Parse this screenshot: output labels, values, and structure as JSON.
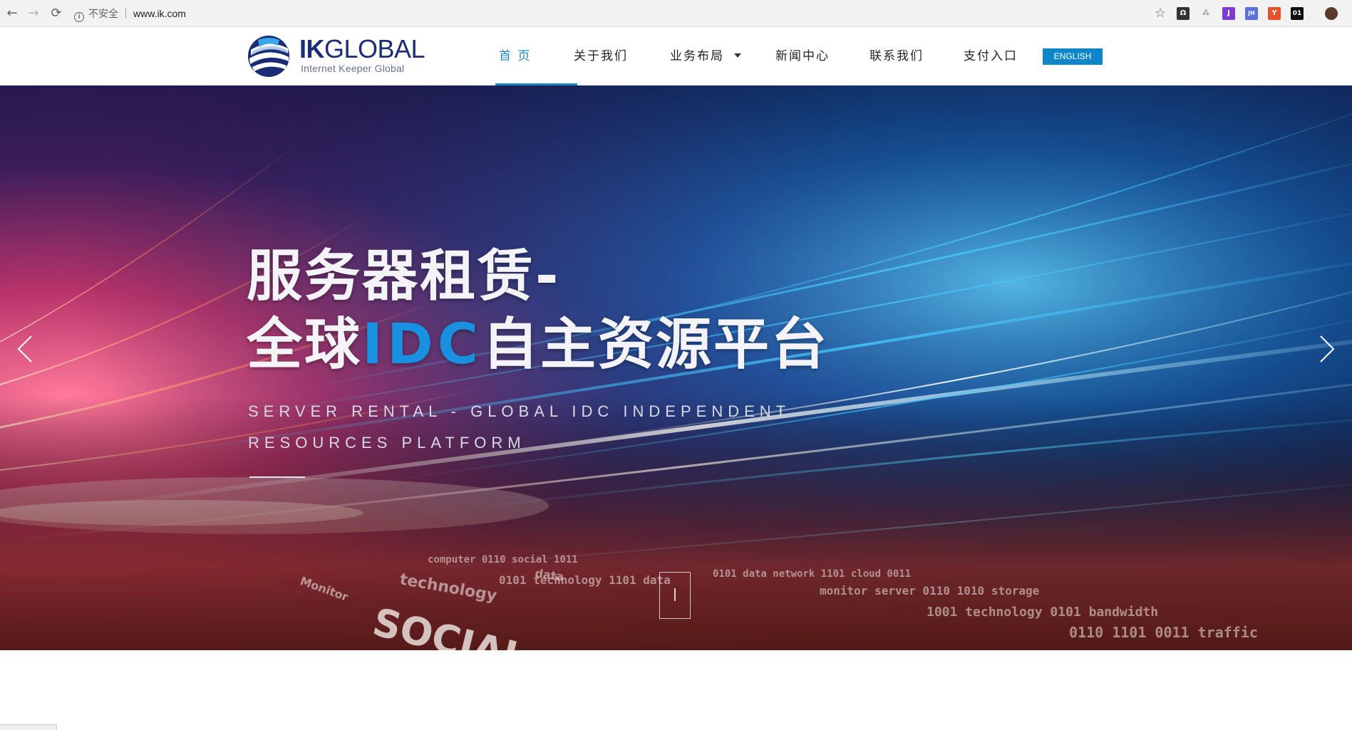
{
  "browser": {
    "security_label": "不安全",
    "url": "www.ik.com",
    "extensions": [
      {
        "name": "octopus-icon",
        "color": "#333333",
        "text": "Ω"
      },
      {
        "name": "sparkle-icon",
        "color": "#9a9a9a",
        "text": "⁂"
      },
      {
        "name": "jrp-icon",
        "color": "#7d3bd1",
        "text": "J"
      },
      {
        "name": "jh-icon",
        "color": "#5a6fd8",
        "text": "JH"
      },
      {
        "name": "ya-icon",
        "color": "#e8502a",
        "text": "Y"
      },
      {
        "name": "zero-one-icon",
        "color": "#111111",
        "text": "01"
      },
      {
        "name": "profile-avatar-icon",
        "color": "#5a3a2a",
        "text": ""
      }
    ]
  },
  "logo": {
    "brand_bold": "IK",
    "brand_rest": "GLOBAL",
    "tagline": "Internet Keeper Global"
  },
  "nav": {
    "items": [
      {
        "label": "首 页",
        "active": true
      },
      {
        "label": "关于我们"
      },
      {
        "label": "业务布局",
        "dropdown": true
      },
      {
        "label": "新闻中心"
      },
      {
        "label": "联系我们"
      },
      {
        "label": "支付入口"
      }
    ],
    "lang_button": "ENGLISH"
  },
  "hero": {
    "title_line1": "服务器租赁-",
    "title_line2_prefix": "全球",
    "title_line2_highlight": "IDC",
    "title_line2_suffix": "自主资源平台",
    "subtitle_line1": "SERVER RENTAL - GLOBAL IDC INDEPENDENT",
    "subtitle_line2": "RESOURCES PLATFORM",
    "background_words": [
      "SOCIAL",
      "technology",
      "Monitor",
      "data"
    ]
  },
  "colors": {
    "accent": "#1e88c8",
    "brand": "#1b2c77",
    "idc_highlight": "#1a90e0"
  }
}
